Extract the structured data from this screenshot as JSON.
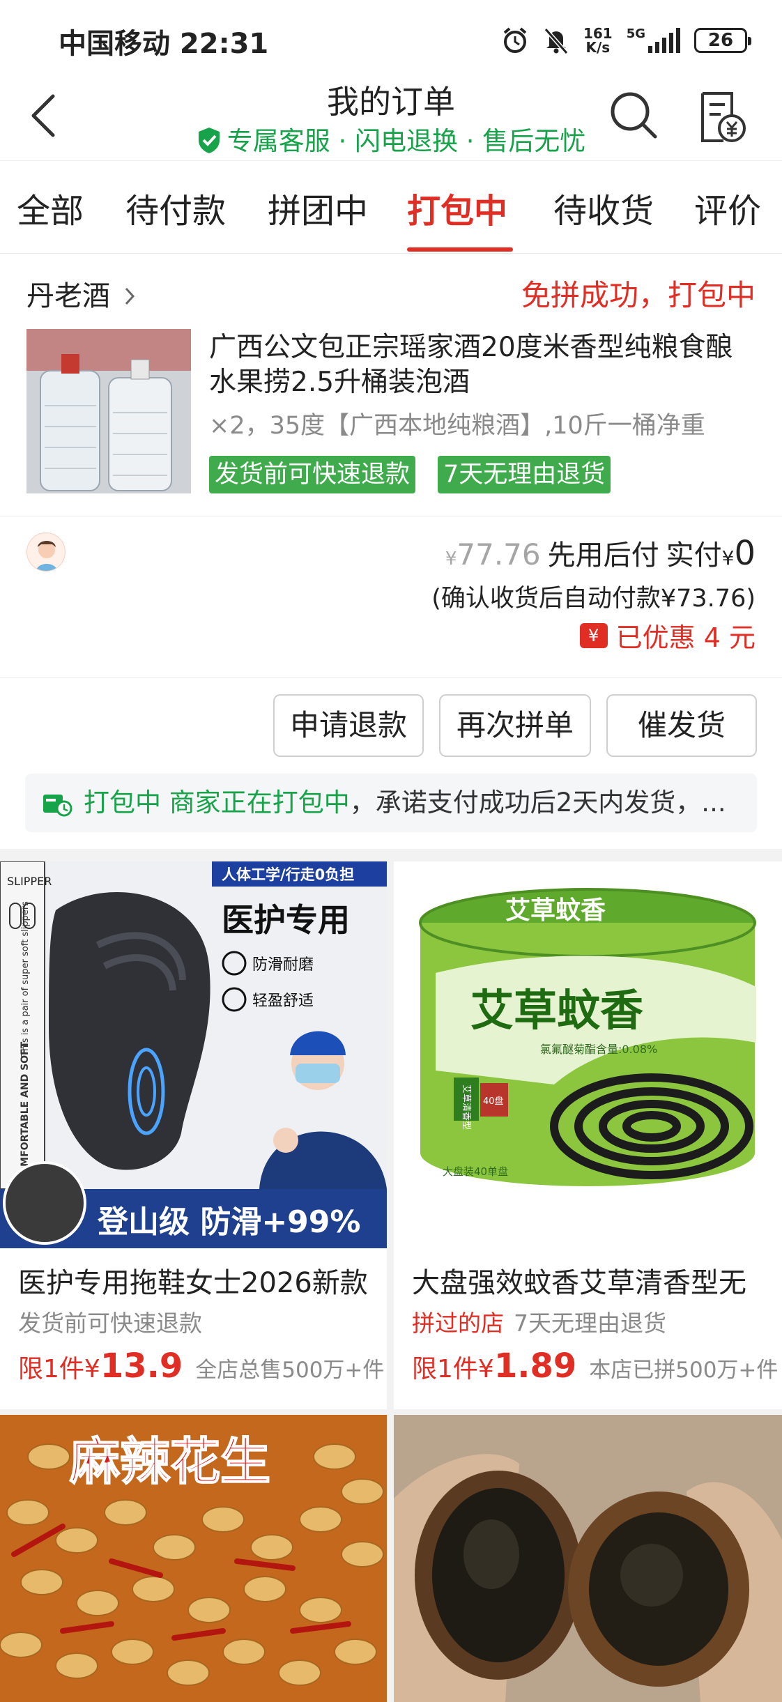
{
  "status_bar": {
    "carrier_time": "中国移动 22:31",
    "net_speed_value": "161",
    "net_speed_unit": "K/s",
    "network": "5G",
    "battery": "26"
  },
  "header": {
    "title": "我的订单",
    "subtitle": "专属客服 · 闪电退换 · 售后无忧"
  },
  "tabs": [
    {
      "label": "全部"
    },
    {
      "label": "待付款"
    },
    {
      "label": "拼团中"
    },
    {
      "label": "打包中",
      "active": true
    },
    {
      "label": "待收货"
    },
    {
      "label": "评价"
    }
  ],
  "order": {
    "shop_name": "丹老酒",
    "status": "免拼成功，打包中",
    "product_title": "广西公文包正宗瑶家酒20度米香型纯粮食酿水果捞2.5升桶装泡酒",
    "spec": "×2，35度【广西本地纯粮酒】,10斤一桶净重",
    "tags": [
      "发货前可快速退款",
      "7天无理由退货"
    ],
    "original_price_symbol": "¥",
    "original_price": "77.76",
    "pay_later_label": "先用后付",
    "actual_pay_label": "实付",
    "actual_pay_symbol": "¥",
    "actual_pay": "0",
    "auto_pay_note": "(确认收货后自动付款¥73.76)",
    "discount_icon": "¥",
    "discount": "已优惠 4 元",
    "buttons": {
      "refund": "申请退款",
      "regroup": "再次拼单",
      "urge": "催发货"
    },
    "notice_status": "打包中",
    "notice_highlight": "商家正在打包中",
    "notice_text": "，承诺支付成功后2天内发货，..."
  },
  "recommendations": [
    {
      "title": "医护专用拖鞋女士2026新款",
      "highlight": "",
      "sub": "发货前可快速退款",
      "price_prefix": "限1件¥",
      "price": "13.9",
      "sold": "全店总售500万+件",
      "banner": "人体工学/行走0负担",
      "headline": "医护专用",
      "feature1": "防滑耐磨",
      "feature2": "轻盈舒适",
      "bottom_text": "登山级 防滑+99%",
      "side_label": "SLIPPER",
      "side_text1": "This is a pair of super soft slippers",
      "side_text2": "COMFORTABLE AND SOFT"
    },
    {
      "title": "大盘强效蚊香艾草清香型无",
      "highlight": "拼过的店",
      "sub": "7天无理由退货",
      "price_prefix": "限1件¥",
      "price": "1.89",
      "sold": "本店已拼500万+件",
      "brand_top": "艾草蚊香",
      "brand_main": "艾草蚊香",
      "brand_note": "氯氟醚菊酯含量:0.08%",
      "side_tag": "艾草清香型",
      "count_tag": "40盘",
      "bottom_note": "大盘装40单盘"
    },
    {
      "title": "",
      "image_text": "麻辣花生"
    },
    {
      "title": ""
    }
  ],
  "colors": {
    "accent_red": "#e02e24",
    "green": "#16a34a",
    "tag_green": "#3fab4c"
  },
  "icons": [
    "back-icon",
    "search-icon",
    "bill-icon",
    "shield-check-icon",
    "truck-icon",
    "chevron-right-icon",
    "discount-icon"
  ]
}
